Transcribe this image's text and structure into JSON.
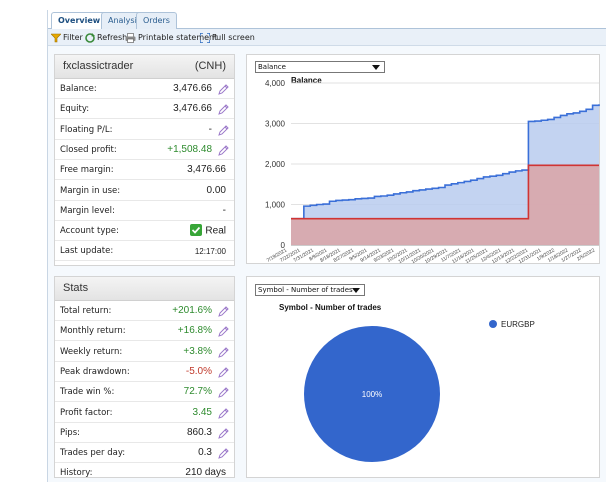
{
  "tabs": [
    {
      "label": "Overview",
      "active": true
    },
    {
      "label": "Analysis",
      "active": false
    },
    {
      "label": "Orders",
      "active": false
    }
  ],
  "toolbar": {
    "filter": "Filter",
    "refresh": "Refresh",
    "printable": "Printable statement",
    "fullscreen": "Full screen"
  },
  "account": {
    "name": "fxclassictrader",
    "currency": "(CNH)",
    "rows": [
      {
        "label": "Balance:",
        "value": "3,476.66",
        "edit": true,
        "tone": ""
      },
      {
        "label": "Equity:",
        "value": "3,476.66",
        "edit": true,
        "tone": ""
      },
      {
        "label": "Floating P/L:",
        "value": "-",
        "edit": true,
        "tone": ""
      },
      {
        "label": "Closed profit:",
        "value": "+1,508.48",
        "edit": true,
        "tone": "pos"
      },
      {
        "label": "Free margin:",
        "value": "3,476.66",
        "edit": false,
        "tone": ""
      },
      {
        "label": "Margin in use:",
        "value": "0.00",
        "edit": false,
        "tone": ""
      },
      {
        "label": "Margin level:",
        "value": "-",
        "edit": false,
        "tone": ""
      },
      {
        "label": "Account type:",
        "value": "Real",
        "edit": false,
        "tone": "",
        "check": true
      },
      {
        "label": "Last update:",
        "value": "12:17:00",
        "edit": false,
        "tone": "",
        "small": true
      }
    ]
  },
  "stats": {
    "title": "Stats",
    "rows": [
      {
        "label": "Total return:",
        "value": "+201.6%",
        "edit": true,
        "tone": "pos"
      },
      {
        "label": "Monthly return:",
        "value": "+16.8%",
        "edit": true,
        "tone": "pos"
      },
      {
        "label": "Weekly return:",
        "value": "+3.8%",
        "edit": true,
        "tone": "pos"
      },
      {
        "label": "Peak drawdown:",
        "value": "-5.0%",
        "edit": true,
        "tone": "neg"
      },
      {
        "label": "Trade win %:",
        "value": "72.7%",
        "edit": true,
        "tone": "pos"
      },
      {
        "label": "Profit factor:",
        "value": "3.45",
        "edit": true,
        "tone": "pos"
      },
      {
        "label": "Pips:",
        "value": "860.3",
        "edit": true,
        "tone": ""
      },
      {
        "label": "Trades per day:",
        "value": "0.3",
        "edit": true,
        "tone": ""
      },
      {
        "label": "History:",
        "value": "210 days",
        "edit": false,
        "tone": ""
      }
    ]
  },
  "balance_chart": {
    "select_value": "Balance",
    "title": "Balance"
  },
  "pie_chart": {
    "select_value": "Symbol - Number of trades",
    "title": "Symbol - Number of trades"
  },
  "colors": {
    "balance_line": "#3a6fd8",
    "balance_fill": "#b9cbee",
    "deposit_line": "#d03434",
    "deposit_fill": "#dba3a6",
    "pie": "#3366cc",
    "positive": "#2e8b2e",
    "negative": "#c0392b"
  },
  "chart_data": [
    {
      "type": "area",
      "title": "Balance",
      "ylim": [
        0,
        4000
      ],
      "yticks": [
        0,
        1000,
        2000,
        3000,
        4000
      ],
      "ytick_labels": [
        "0",
        "1,000",
        "2,000",
        "3,000",
        "4,000"
      ],
      "xtick_labels": [
        "7/19/2021",
        "7/22/2021",
        "7/31/2021",
        "8/9/2021",
        "8/18/2021",
        "8/27/2021",
        "9/5/2021",
        "9/14/2021",
        "9/23/2021",
        "10/2/2021",
        "10/11/2021",
        "10/20/2021",
        "10/29/2021",
        "11/7/2021",
        "11/16/2021",
        "11/25/2021",
        "12/4/2021",
        "12/13/2021",
        "12/22/2021",
        "12/31/2021",
        "1/9/2022",
        "1/18/2022",
        "1/27/2022",
        "2/5/2022"
      ],
      "grid": true,
      "legend": "none",
      "series": [
        {
          "values": [
            650,
            650,
            960,
            980,
            1000,
            1010,
            1080,
            1100,
            1110,
            1120,
            1140,
            1150,
            1160,
            1200,
            1210,
            1230,
            1260,
            1290,
            1310,
            1340,
            1360,
            1380,
            1400,
            1420,
            1480,
            1510,
            1540,
            1570,
            1600,
            1640,
            1680,
            1700,
            1720,
            1760,
            1800,
            1830,
            1850,
            3050,
            3060,
            3080,
            3100,
            3150,
            3200,
            3240,
            3260,
            3300,
            3350,
            3450,
            3476
          ]
        },
        {
          "values": [
            650,
            650,
            650,
            650,
            650,
            650,
            650,
            650,
            650,
            650,
            650,
            650,
            650,
            650,
            650,
            650,
            650,
            650,
            650,
            650,
            650,
            650,
            650,
            650,
            650,
            650,
            650,
            650,
            650,
            650,
            650,
            650,
            650,
            650,
            650,
            650,
            650,
            1968,
            1968,
            1968,
            1968,
            1968,
            1968,
            1968,
            1968,
            1968,
            1968,
            1968,
            1968
          ]
        }
      ]
    },
    {
      "type": "pie",
      "title": "Symbol - Number of trades",
      "categories": [
        "EURGBP"
      ],
      "values": [
        100
      ],
      "slice_labels": [
        "100%"
      ],
      "legend": "top-right"
    }
  ]
}
